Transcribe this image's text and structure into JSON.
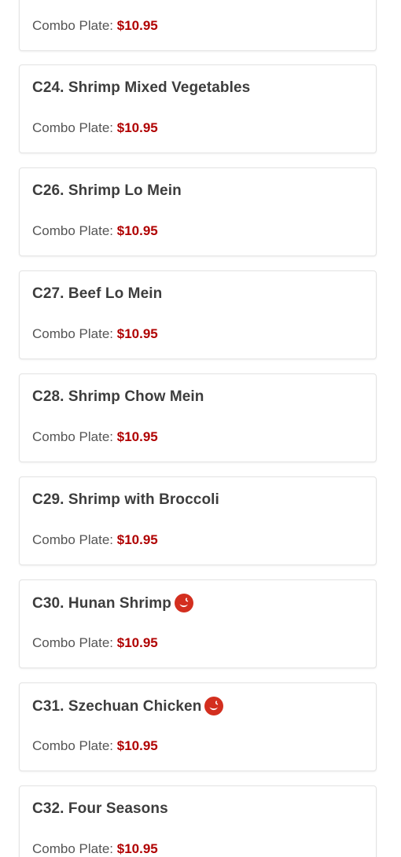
{
  "colors": {
    "price": "#b00000",
    "title": "#3d3d3d",
    "label": "#555555",
    "spicy_icon": "#d32f1f",
    "card_border": "#e3e3e3"
  },
  "items": [
    {
      "name": "",
      "spicy": false,
      "price_label": "Combo Plate:",
      "price": "$10.95"
    },
    {
      "name": "C24. Shrimp Mixed Vegetables",
      "spicy": false,
      "price_label": "Combo Plate:",
      "price": "$10.95"
    },
    {
      "name": "C26. Shrimp Lo Mein",
      "spicy": false,
      "price_label": "Combo Plate:",
      "price": "$10.95"
    },
    {
      "name": "C27. Beef Lo Mein",
      "spicy": false,
      "price_label": "Combo Plate:",
      "price": "$10.95"
    },
    {
      "name": "C28. Shrimp Chow Mein",
      "spicy": false,
      "price_label": "Combo Plate:",
      "price": "$10.95"
    },
    {
      "name": "C29. Shrimp with Broccoli",
      "spicy": false,
      "price_label": "Combo Plate:",
      "price": "$10.95"
    },
    {
      "name": "C30. Hunan Shrimp",
      "spicy": true,
      "spicy_icon": "chili-pepper-icon",
      "price_label": "Combo Plate:",
      "price": "$10.95"
    },
    {
      "name": "C31. Szechuan Chicken",
      "spicy": true,
      "spicy_icon": "chili-pepper-icon",
      "price_label": "Combo Plate:",
      "price": "$10.95"
    },
    {
      "name": "C32. Four Seasons",
      "spicy": false,
      "price_label": "Combo Plate:",
      "price": "$10.95"
    }
  ]
}
